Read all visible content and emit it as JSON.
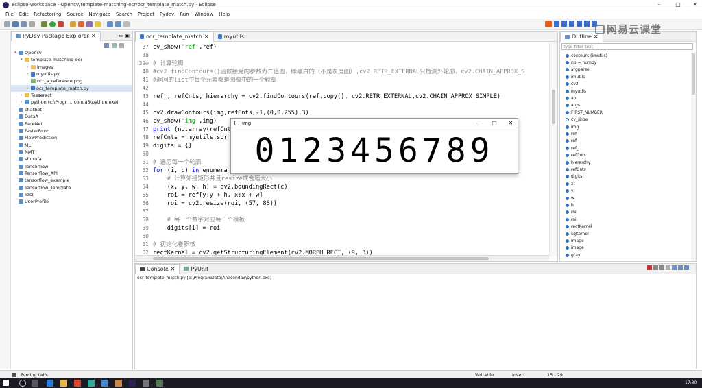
{
  "window": {
    "title": "eclipse-workspace - Opencv/template-matching-ocr/ocr_template_match.py - Eclipse",
    "min": "–",
    "max": "□",
    "close": "✕"
  },
  "menu": [
    "File",
    "Edit",
    "Refactoring",
    "Source",
    "Navigate",
    "Search",
    "Project",
    "Pydev",
    "Run",
    "Window",
    "Help"
  ],
  "explorer": {
    "title": "PyDev Package Explorer",
    "items": [
      {
        "label": "Opencv",
        "indent": 0,
        "icon": "proj",
        "arrow": "▾"
      },
      {
        "label": "template-matching-ocr",
        "indent": 1,
        "icon": "folder",
        "arrow": "▾"
      },
      {
        "label": "images",
        "indent": 2,
        "icon": "folder",
        "arrow": "›"
      },
      {
        "label": "myutils.py",
        "indent": 2,
        "icon": "pyfile",
        "arrow": "›"
      },
      {
        "label": "ocr_a_reference.png",
        "indent": 2,
        "icon": "img",
        "arrow": ""
      },
      {
        "label": "ocr_template_match.py",
        "indent": 2,
        "icon": "pyfile",
        "arrow": "›",
        "selected": true
      },
      {
        "label": "Tesseract",
        "indent": 1,
        "icon": "folder",
        "arrow": "›"
      },
      {
        "label": "python  (c:\\Progr ... conda3\\python.exe)",
        "indent": 1,
        "icon": "proj",
        "arrow": "›"
      },
      {
        "label": "chatbot",
        "indent": 0,
        "icon": "proj",
        "arrow": ""
      },
      {
        "label": "DataA",
        "indent": 0,
        "icon": "proj",
        "arrow": ""
      },
      {
        "label": "FaceNet",
        "indent": 0,
        "icon": "proj",
        "arrow": ""
      },
      {
        "label": "FasterRcnn",
        "indent": 0,
        "icon": "proj",
        "arrow": ""
      },
      {
        "label": "FlowPrediction",
        "indent": 0,
        "icon": "proj",
        "arrow": ""
      },
      {
        "label": "ML",
        "indent": 0,
        "icon": "proj",
        "arrow": ""
      },
      {
        "label": "NMT",
        "indent": 0,
        "icon": "proj",
        "arrow": ""
      },
      {
        "label": "shurufa",
        "indent": 0,
        "icon": "proj",
        "arrow": ""
      },
      {
        "label": "Tensorflow",
        "indent": 0,
        "icon": "proj",
        "arrow": ""
      },
      {
        "label": "Tensorflow_API",
        "indent": 0,
        "icon": "proj",
        "arrow": ""
      },
      {
        "label": "tensorflow_example",
        "indent": 0,
        "icon": "proj",
        "arrow": ""
      },
      {
        "label": "Tensorflow_Template",
        "indent": 0,
        "icon": "proj",
        "arrow": ""
      },
      {
        "label": "Test",
        "indent": 0,
        "icon": "proj",
        "arrow": ""
      },
      {
        "label": "UserProfile",
        "indent": 0,
        "icon": "proj",
        "arrow": ""
      }
    ]
  },
  "editor": {
    "tabs": [
      {
        "label": "ocr_template_match",
        "active": true
      },
      {
        "label": "myutils",
        "active": false
      }
    ],
    "lines": [
      {
        "n": "37",
        "html": "cv_show(<span class=\"str\">'ref'</span>,ref)"
      },
      {
        "n": "38",
        "html": ""
      },
      {
        "n": "39⊖",
        "html": "<span class=\"cmt\"># 计算轮廓</span>"
      },
      {
        "n": "40",
        "html": "<span class=\"cmt\">#cv2.findContours()函数接受的参数为二值图，即黑白的（不是灰度图）,cv2.RETR_EXTERNAL只检测外轮廓，cv2.CHAIN_APPROX_S</span>"
      },
      {
        "n": "41",
        "html": "<span class=\"cmt\">#返回的list中每个元素都是图像中的一个轮廓</span>"
      },
      {
        "n": "42",
        "html": ""
      },
      {
        "n": "43",
        "html": "ref_, refCnts, hierarchy = cv2.findContours(ref.copy(), cv2.RETR_EXTERNAL,cv2.CHAIN_APPROX_SIMPLE)"
      },
      {
        "n": "44",
        "html": ""
      },
      {
        "n": "45",
        "html": "cv2.drawContours(img,refCnts,-1,(0,0,255),3)"
      },
      {
        "n": "46",
        "html": "cv_show(<span class=\"str\">'img'</span>,img)"
      },
      {
        "n": "47",
        "html": "<span class=\"kw\">print</span> (np.array(refCnts"
      },
      {
        "n": "48",
        "html": "refCnts = myutils.sor"
      },
      {
        "n": "49",
        "html": "digits = {}"
      },
      {
        "n": "50",
        "html": ""
      },
      {
        "n": "51",
        "html": "<span class=\"cmt\"># 遍历每一个轮廓</span>"
      },
      {
        "n": "52",
        "html": "<span class=\"kw\">for</span> (i, c) <span class=\"kw\">in</span> enumera"
      },
      {
        "n": "53",
        "html": "    <span class=\"cmt\"># 计算外接矩形并且resize成合适大小</span>"
      },
      {
        "n": "54",
        "html": "    (x, y, w, h) = cv2.boundingRect(c)"
      },
      {
        "n": "55",
        "html": "    roi = ref[y:y + h, x:x + w]"
      },
      {
        "n": "56",
        "html": "    roi = cv2.resize(roi, (57, 88))"
      },
      {
        "n": "57",
        "html": ""
      },
      {
        "n": "58",
        "html": "    <span class=\"cmt\"># 每一个数字对应每一个模板</span>"
      },
      {
        "n": "59",
        "html": "    digits[i] = roi"
      },
      {
        "n": "60",
        "html": ""
      },
      {
        "n": "61",
        "html": "<span class=\"cmt\"># 初始化卷积核</span>"
      },
      {
        "n": "62",
        "html": "rectKernel = cv2.getStructuringElement(cv2.MORPH_RECT, (9, 3))"
      }
    ]
  },
  "popup": {
    "title": "img",
    "digits": "0123456789",
    "min": "–",
    "max": "□",
    "close": "✕"
  },
  "outline": {
    "title": "Outline",
    "filter_placeholder": "type filter text",
    "items": [
      {
        "label": "contours (imutils)",
        "type": "f"
      },
      {
        "label": "np = numpy",
        "type": "f"
      },
      {
        "label": "argparse",
        "type": "f"
      },
      {
        "label": "imutils",
        "type": "f"
      },
      {
        "label": "cv2",
        "type": "f"
      },
      {
        "label": "myutils",
        "type": "f"
      },
      {
        "label": "ap",
        "type": "f"
      },
      {
        "label": "args",
        "type": "f"
      },
      {
        "label": "FIRST_NUMBER",
        "type": "f"
      },
      {
        "label": "cv_show",
        "type": "o"
      },
      {
        "label": "img",
        "type": "f"
      },
      {
        "label": "ref",
        "type": "f"
      },
      {
        "label": "ref",
        "type": "f"
      },
      {
        "label": "ref_",
        "type": "f"
      },
      {
        "label": "refCnts",
        "type": "f"
      },
      {
        "label": "hierarchy",
        "type": "f"
      },
      {
        "label": "refCnts",
        "type": "f"
      },
      {
        "label": "digits",
        "type": "f"
      },
      {
        "label": "x",
        "type": "f"
      },
      {
        "label": "y",
        "type": "f"
      },
      {
        "label": "w",
        "type": "f"
      },
      {
        "label": "h",
        "type": "f"
      },
      {
        "label": "roi",
        "type": "f"
      },
      {
        "label": "roi",
        "type": "f"
      },
      {
        "label": "rectKernel",
        "type": "f"
      },
      {
        "label": "sqKernel",
        "type": "f"
      },
      {
        "label": "image",
        "type": "f"
      },
      {
        "label": "image",
        "type": "f"
      },
      {
        "label": "gray",
        "type": "f"
      }
    ]
  },
  "console": {
    "tabs": [
      {
        "label": "Console",
        "active": true
      },
      {
        "label": "PyUnit",
        "active": false
      }
    ],
    "text": "ocr_template_match.py [e:\\ProgramData\\Anaconda3\\python.exe]"
  },
  "status": {
    "left": "Forcing tabs",
    "writable": "Writable",
    "insert": "Insert",
    "position": "15 : 29"
  },
  "watermark": "网易云课堂",
  "taskbar": {
    "clock": "17:30"
  },
  "colors": {
    "accent": "#3a6fc4",
    "comment": "#8a8a8a",
    "string": "#00a000",
    "keyword": "#0000c8"
  }
}
